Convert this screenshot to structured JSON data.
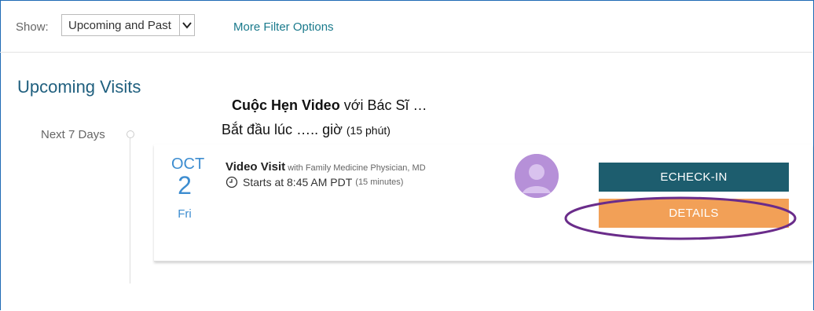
{
  "filter": {
    "show_label": "Show:",
    "select_value": "Upcoming and Past",
    "more_filters": "More Filter Options"
  },
  "section_title": "Upcoming Visits",
  "overlay": {
    "line1_bold": "Cuộc Hẹn Video",
    "line1_rest": " với Bác Sĩ …",
    "line2": "Bắt đầu lúc ….. giờ ",
    "line2_small": "(15 phút)"
  },
  "timeline": {
    "label": "Next 7 Days"
  },
  "visit": {
    "month": "OCT",
    "day": "2",
    "weekday": "Fri",
    "title": "Video Visit",
    "with": " with Family Medicine Physician, MD",
    "time": "Starts at 8:45 AM PDT",
    "duration": "(15 minutes)"
  },
  "buttons": {
    "checkin": "ECHECK-IN",
    "details": "DETAILS"
  },
  "colors": {
    "accent": "#1d5d6e",
    "details": "#f2a057",
    "date": "#3d8dd0",
    "annotation": "#6a2c8a"
  }
}
